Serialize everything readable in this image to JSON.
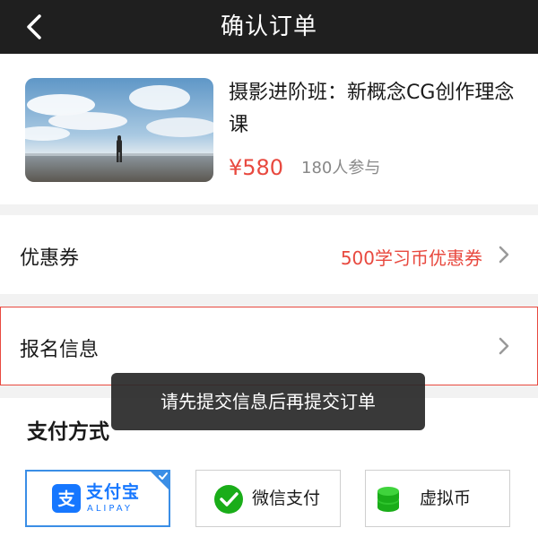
{
  "header": {
    "title": "确认订单",
    "back_icon": "chevron-left-icon"
  },
  "course": {
    "title": "摄影进阶班：新概念CG创作理念课",
    "price": "¥580",
    "participants": "180人参与"
  },
  "coupon": {
    "label": "优惠券",
    "value": "500学习币优惠券"
  },
  "signup": {
    "label": "报名信息"
  },
  "toast": {
    "message": "请先提交信息后再提交订单"
  },
  "payment": {
    "title": "支付方式",
    "options": [
      {
        "name": "支付宝",
        "sub": "ALIPAY",
        "icon": "alipay-icon",
        "selected": true
      },
      {
        "name": "微信支付",
        "icon": "wechat-pay-icon",
        "selected": false
      },
      {
        "name": "虚拟币",
        "icon": "coin-stack-icon",
        "selected": false
      }
    ]
  },
  "colors": {
    "accent_red": "#e8493f",
    "selected_blue": "#3a8ee6",
    "alipay_blue": "#1677ff",
    "wechat_green": "#1aad19"
  }
}
